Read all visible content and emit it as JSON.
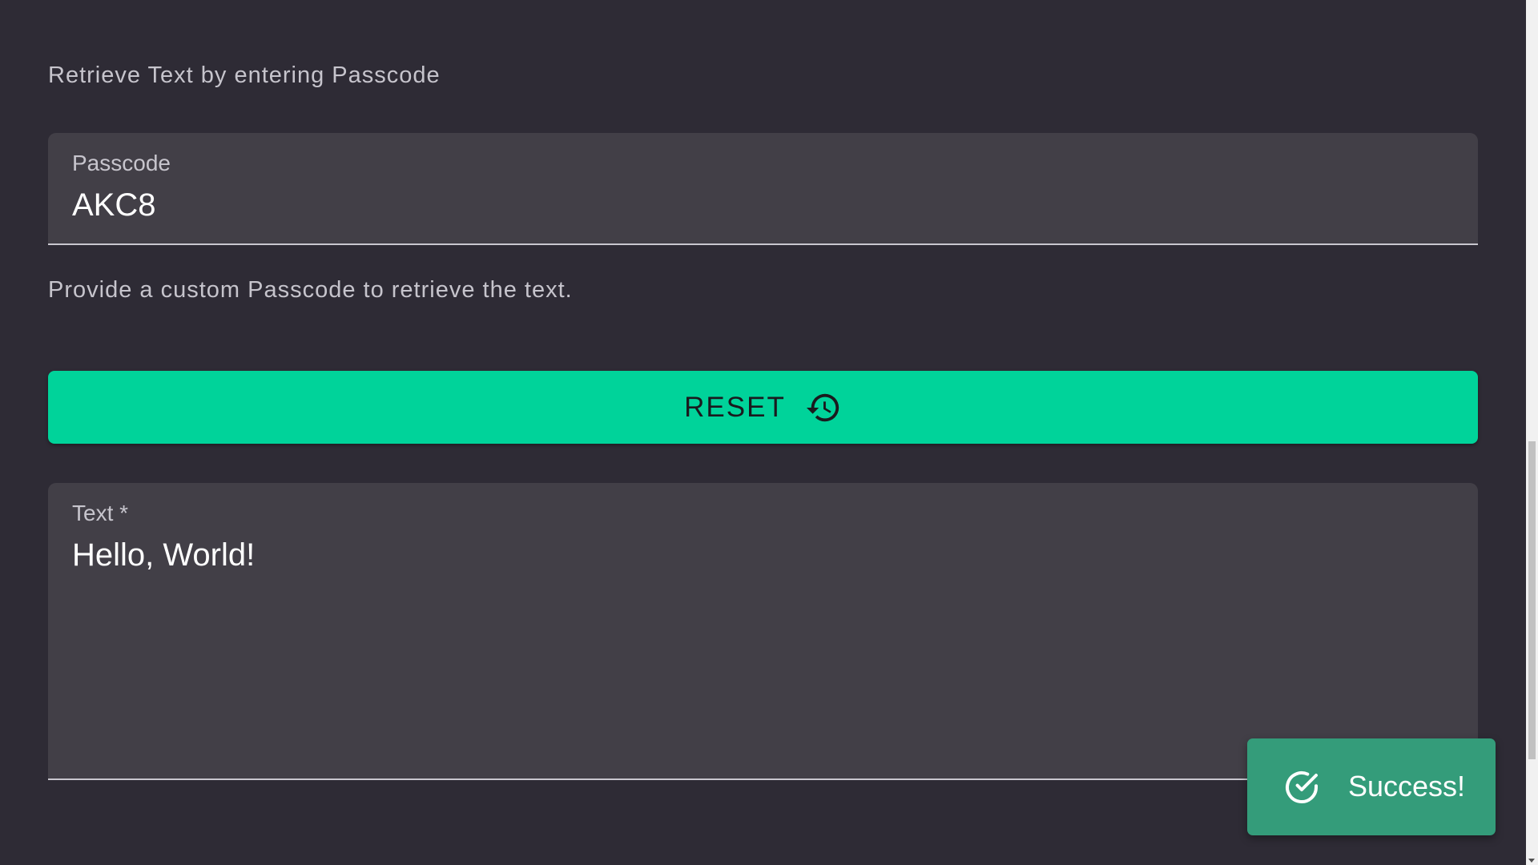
{
  "heading": "Retrieve Text by entering Passcode",
  "passcode_field": {
    "label": "Passcode",
    "value": "AKC8"
  },
  "helper_text": "Provide a custom Passcode to retrieve the text.",
  "reset_button": {
    "label": "RESET",
    "icon": "history-icon"
  },
  "text_field": {
    "label": "Text *",
    "value": "Hello, World!"
  },
  "toast": {
    "icon": "check-circle-icon",
    "message": "Success!"
  },
  "colors": {
    "background": "#2e2b35",
    "field_background": "#423f47",
    "accent": "#00d39a",
    "toast_background": "#349c7a"
  }
}
